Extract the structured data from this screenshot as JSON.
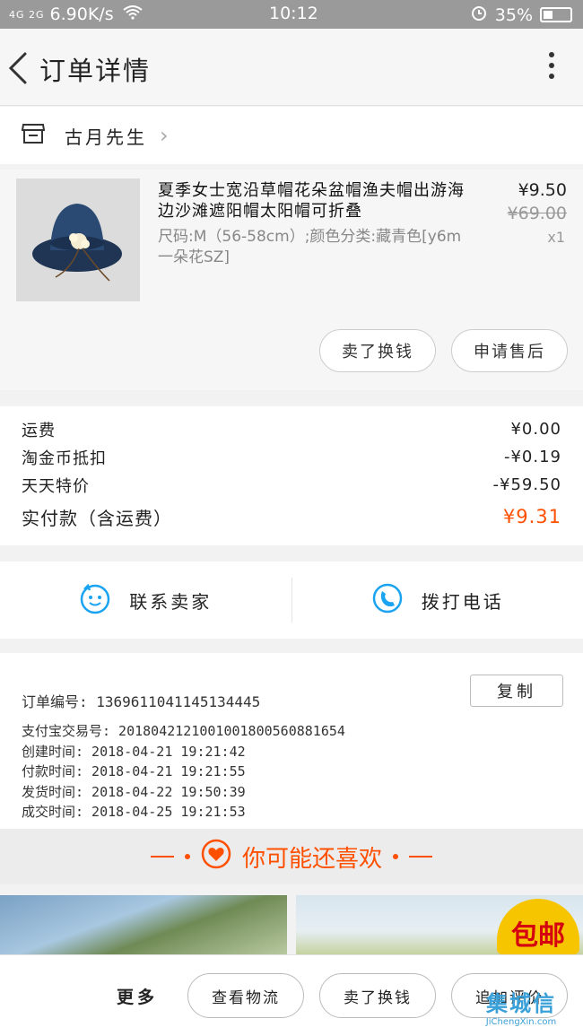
{
  "statusbar": {
    "signal_left": "4G 2G",
    "net_speed": "6.90K/s",
    "time": "10:12",
    "battery": "35%"
  },
  "topbar": {
    "title": "订单详情"
  },
  "shop": {
    "name": "古月先生"
  },
  "product": {
    "title": "夏季女士宽沿草帽花朵盆帽渔夫帽出游海边沙滩遮阳帽太阳帽可折叠",
    "spec": "尺码:M（56-58cm）;颜色分类:藏青色[y6m一朵花SZ]",
    "price": "¥9.50",
    "original_price": "¥69.00",
    "quantity": "x1",
    "sell_button": "卖了换钱",
    "after_sale_button": "申请售后"
  },
  "fees": {
    "items": [
      {
        "label": "运费",
        "value": "¥0.00"
      },
      {
        "label": "淘金币抵扣",
        "value": "-¥0.19"
      },
      {
        "label": "天天特价",
        "value": "-¥59.50"
      }
    ],
    "total_label": "实付款（含运费）",
    "total_value": "¥9.31"
  },
  "contact": {
    "seller": "联系卖家",
    "phone": "拨打电话"
  },
  "order_info": {
    "order_no": "订单编号: 1369611041145134445",
    "copy_button": "复制",
    "rows": [
      "支付宝交易号: 2018042121001001800560881654",
      "创建时间: 2018-04-21 19:21:42",
      "付款时间: 2018-04-21 19:21:55",
      "发货时间: 2018-04-22 19:50:39",
      "成交时间: 2018-04-25 19:21:53"
    ]
  },
  "recommend": {
    "title": "你可能还喜欢",
    "badge": "包邮"
  },
  "bottombar": {
    "more": "更多",
    "logistics": "查看物流",
    "sell": "卖了换钱",
    "review": "追加评价"
  },
  "watermark": {
    "main": "集城信",
    "sub": "JiChengXin.com"
  },
  "colors": {
    "accent": "#ff5000",
    "icon_blue": "#1aa3f0"
  }
}
